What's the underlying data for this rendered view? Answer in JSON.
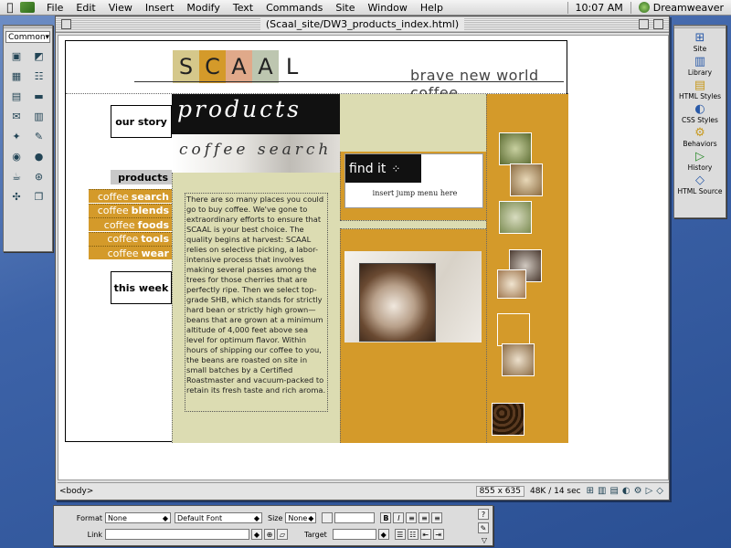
{
  "menubar": {
    "items": [
      "File",
      "Edit",
      "View",
      "Insert",
      "Modify",
      "Text",
      "Commands",
      "Site",
      "Window",
      "Help"
    ],
    "clock": "10:07 AM",
    "app_name": "Dreamweaver"
  },
  "objects_palette": {
    "selector": "Common"
  },
  "document": {
    "title": "(Scaal_site/DW3_products_index.html)",
    "status_tag": "<body>",
    "window_size": "855 x 635",
    "download": "48K / 14 sec"
  },
  "page": {
    "logo_letters": [
      "S",
      "C",
      "A",
      "A",
      "L"
    ],
    "logo_colors": [
      "#d5c88b",
      "#d49a2a",
      "#e0a98a",
      "#bdc6b0",
      "#ffffff"
    ],
    "tagline": "brave new world coffee",
    "nav": {
      "our_story": "our story",
      "products": "products",
      "this_week": "this week",
      "subnav": [
        {
          "prefix": "coffee",
          "word": "search"
        },
        {
          "prefix": "coffee",
          "word": "blends"
        },
        {
          "prefix": "coffee",
          "word": "foods"
        },
        {
          "prefix": "coffee",
          "word": "tools"
        },
        {
          "prefix": "coffee",
          "word": "wear"
        }
      ]
    },
    "products_header": "products",
    "search_header": "coffee search",
    "body_text": "There are so many places you could go to buy coffee. We've gone to extraordinary efforts to ensure that SCAAL is your best choice. The quality begins at harvest: SCAAL relies on selective picking, a labor-intensive process that involves making several passes among the trees for those cherries that are perfectly ripe. Then we select top-grade SHB, which stands for strictly hard bean or strictly high grown—beans that are grown at a minimum altitude of 4,000 feet above sea level for optimum flavor. Within hours of shipping our coffee to you, the beans are roasted on site in small batches by a Certified Roastmaster and vacuum-packed to retain its fresh taste and rich aroma.",
    "find_it": "find it",
    "jump_menu": "insert jump menu here"
  },
  "launcher": {
    "items": [
      "Site",
      "Library",
      "HTML Styles",
      "CSS Styles",
      "Behaviors",
      "History",
      "HTML Source"
    ]
  },
  "properties": {
    "format_label": "Format",
    "format_value": "None",
    "font_value": "Default Font",
    "size_label": "Size",
    "size_value": "None",
    "link_label": "Link",
    "target_label": "Target"
  },
  "colors": {
    "mustard": "#d49a2a",
    "sage": "#dcdcb2",
    "desktop": "#3d63a8"
  }
}
